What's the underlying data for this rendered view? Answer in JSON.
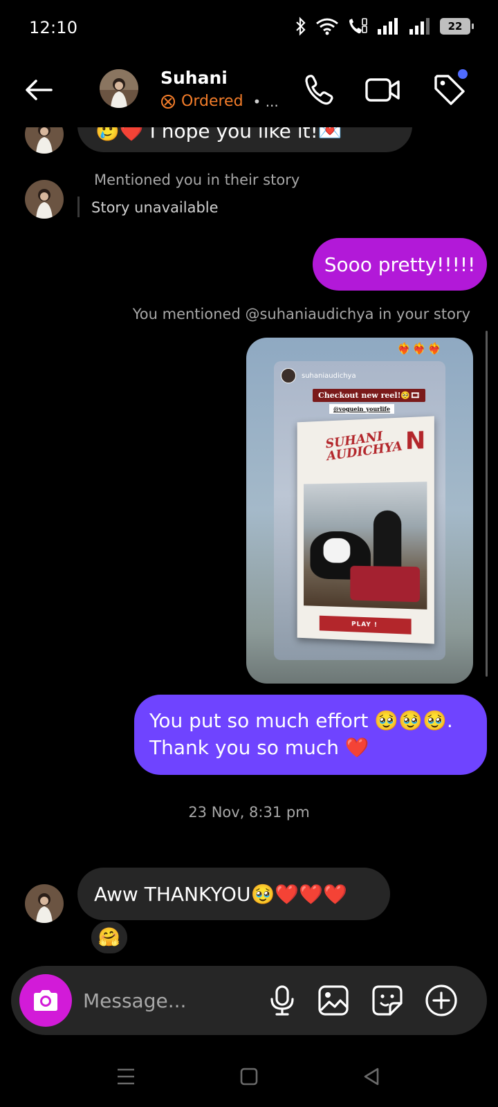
{
  "status_bar": {
    "time": "12:10",
    "battery": "22"
  },
  "header": {
    "contact_name": "Suhani",
    "status_label": "Ordered",
    "status_more": "• ...",
    "icons": [
      "back-arrow-icon",
      "phone-icon",
      "video-camera-icon",
      "tag-icon"
    ],
    "status_color": "#f47d2a",
    "notification_dot_color": "#4f6bff"
  },
  "messages": {
    "partial_top": "🥲❤️ I hope you like it!💌",
    "story_mention_in": "Mentioned you in their story",
    "story_unavailable": "Story unavailable",
    "out_1": "Sooo pretty!!!!!",
    "story_mention_out": "You mentioned @suhaniaudichya in your story",
    "story_card": {
      "username": "suhaniaudichya",
      "reel_tag": "Checkout new reel!🥺🎞",
      "handle_tag": "@voguein_yourlife",
      "poster_title_line1": "SUHANI",
      "poster_title_line2": "AUDICHYA",
      "poster_letter": "N",
      "play_label": "PLAY !",
      "hearts": "❤️‍🔥❤️‍🔥❤️‍🔥"
    },
    "out_2_line1": "You put so much effort 🥹🥹🥹.",
    "out_2_line2": "Thank you so much ❤️",
    "timestamp": "23 Nov, 8:31 pm",
    "in_last": "Aww THANKYOU🥹❤️❤️❤️",
    "reaction": "🤗"
  },
  "composer": {
    "placeholder": "Message...",
    "icons": [
      "camera-icon",
      "microphone-icon",
      "gallery-icon",
      "sticker-icon",
      "plus-circle-icon"
    ],
    "camera_color": "#d21bd8"
  },
  "colors": {
    "outgoing_gradient_top": "#a21bdc",
    "outgoing_bubble_1": "#b219d8",
    "outgoing_bubble_2": "#6f44ff",
    "incoming_bubble": "#262626"
  }
}
